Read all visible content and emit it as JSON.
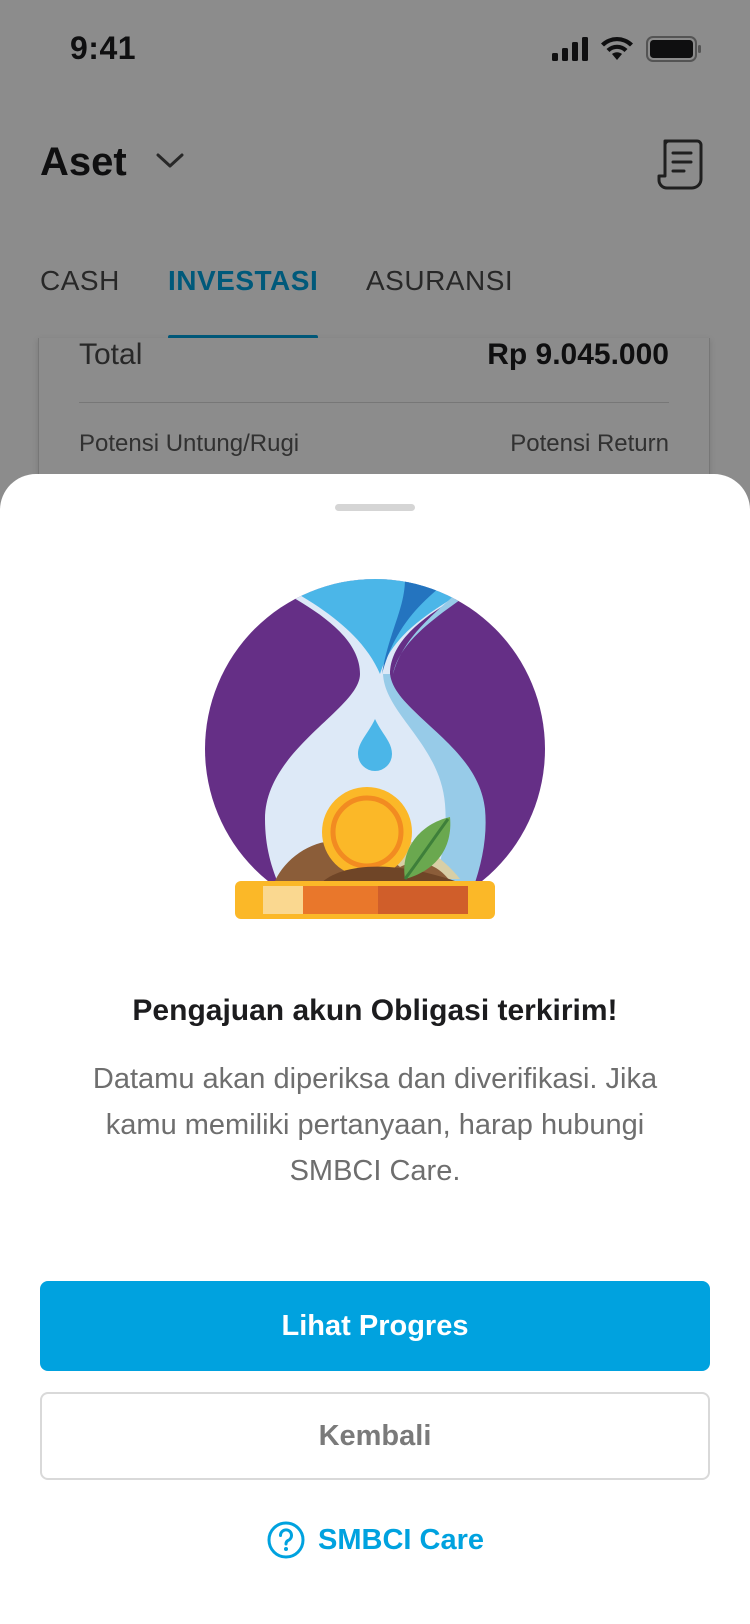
{
  "status_bar": {
    "time": "9:41"
  },
  "header": {
    "title": "Aset"
  },
  "tabs": [
    {
      "label": "CASH"
    },
    {
      "label": "INVESTASI"
    },
    {
      "label": "ASURANSI"
    }
  ],
  "summary": {
    "total_label": "Total",
    "total_value": "Rp 9.045.000",
    "profit_label": "Potensi Untung/Rugi",
    "return_label": "Potensi Return"
  },
  "sheet": {
    "title": "Pengajuan akun Obligasi terkirim!",
    "description": "Datamu akan diperiksa dan diverifikasi. Jika kamu memiliki pertanyaan, harap hubungi SMBCI Care.",
    "primary_button": "Lihat Progres",
    "secondary_button": "Kembali",
    "care_link": "SMBCI Care"
  },
  "colors": {
    "accent": "#00a2df",
    "illustration_purple": "#652f86",
    "illustration_light_blue": "#4bb6e8",
    "illustration_coin": "#fbb828"
  }
}
